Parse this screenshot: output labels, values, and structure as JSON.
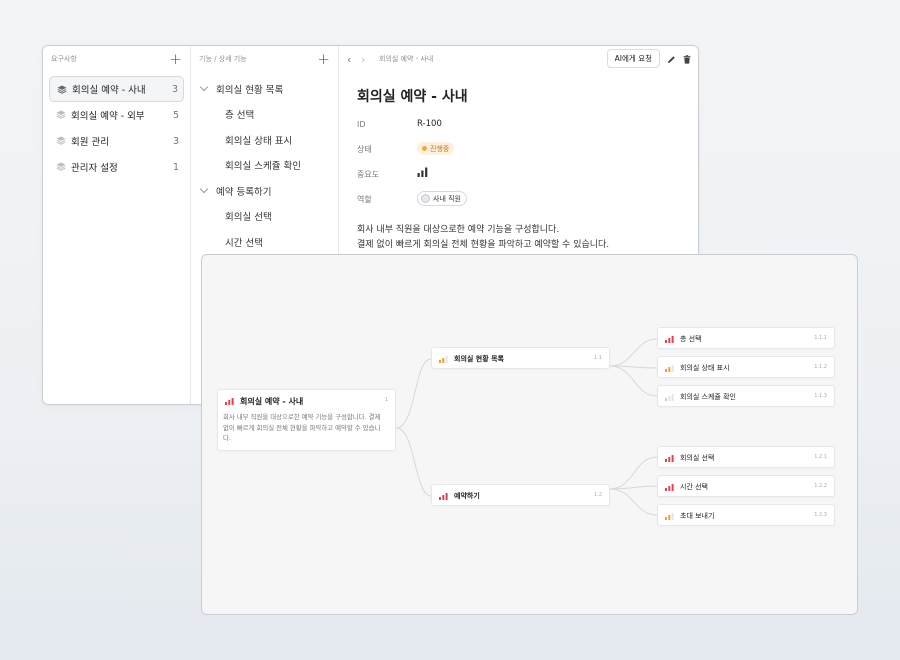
{
  "requirements": {
    "header": "요구사항",
    "items": [
      {
        "label": "회의실 예약 - 사내",
        "count": "3",
        "selected": true
      },
      {
        "label": "회의실 예약 - 외부",
        "count": "5",
        "selected": false
      },
      {
        "label": "회원 관리",
        "count": "3",
        "selected": false
      },
      {
        "label": "관리자 설정",
        "count": "1",
        "selected": false
      }
    ]
  },
  "features": {
    "header": "기능 / 상세 기능",
    "items": [
      {
        "label": "회의실 현황 목록",
        "level": "parent"
      },
      {
        "label": "층 선택",
        "level": "child"
      },
      {
        "label": "회의실 상태 표시",
        "level": "child"
      },
      {
        "label": "회의실 스케쥴 확인",
        "level": "child"
      },
      {
        "label": "예약 등록하기",
        "level": "parent"
      },
      {
        "label": "회의실 선택",
        "level": "child"
      },
      {
        "label": "시간 선택",
        "level": "child"
      }
    ]
  },
  "detail": {
    "breadcrumb": "회의실 예약 - 사내",
    "ai_button": "AI에게 요청",
    "title": "회의실 예약 - 사내",
    "props": {
      "id_label": "ID",
      "id_value": "R-100",
      "status_label": "상태",
      "status_value": "진행중",
      "priority_label": "중요도",
      "role_label": "역할",
      "role_value": "사내 직원"
    },
    "description": [
      "회사 내부 직원을 대상으로한 예약 기능을 구성합니다.",
      "결제 없이 빠르게 회의실 전체 현황을 파악하고 예약할 수 있습니다."
    ]
  },
  "mindmap": {
    "root": {
      "label": "회의실 예약 - 사내",
      "num": "1",
      "desc": "회사 내부 직원을 대상으로한 예약 기능을 구성합니다. 결제 없이 빠르게 회의실 전체 현황을 파악하고 예약할 수 있습니다."
    },
    "branches": [
      {
        "label": "회의실 현황 목록",
        "num": "1.1",
        "priority": "medium",
        "children": [
          {
            "label": "층 선택",
            "num": "1.1.1",
            "priority": "high"
          },
          {
            "label": "회의실 상태 표시",
            "num": "1.1.2",
            "priority": "medium"
          },
          {
            "label": "회의실 스케쥴 확인",
            "num": "1.1.3",
            "priority": "low"
          }
        ]
      },
      {
        "label": "예약하기",
        "num": "1.2",
        "priority": "high",
        "children": [
          {
            "label": "회의실 선택",
            "num": "1.2.1",
            "priority": "high"
          },
          {
            "label": "시간 선택",
            "num": "1.2.2",
            "priority": "high"
          },
          {
            "label": "초대 보내기",
            "num": "1.2.3",
            "priority": "medium"
          }
        ]
      }
    ],
    "colors": {
      "high": "#e0424f",
      "medium": "#f0a030",
      "low": "#c8cbcf",
      "inactive": "#e2e4e7"
    }
  }
}
